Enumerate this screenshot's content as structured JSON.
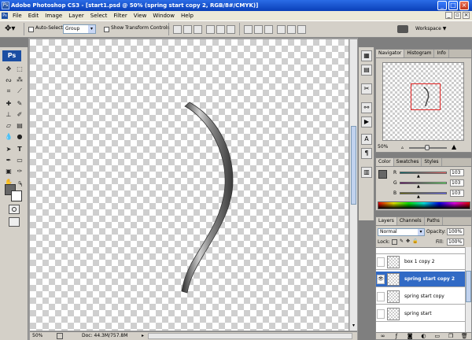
{
  "window": {
    "title": "Adobe Photoshop CS3 - [start1.psd @ 50% (spring start copy 2, RGB/8#/CMYK)]",
    "minimize": "_",
    "maximize": "□",
    "close": "×"
  },
  "app": {
    "logo": "Ps"
  },
  "menu": [
    "File",
    "Edit",
    "Image",
    "Layer",
    "Select",
    "Filter",
    "View",
    "Window",
    "Help"
  ],
  "doc_controls": {
    "minimize": "_",
    "restore": "▫",
    "close": "×"
  },
  "options": {
    "auto_select_label": "Auto-Select:",
    "auto_select_value": "Group",
    "show_transform_label": "Show Transform Controls",
    "workspace_label": "Workspace ▼"
  },
  "status": {
    "zoom": "50%",
    "doc": "Doc: 44.3M/757.8M"
  },
  "navigator": {
    "tabs": [
      "Navigator",
      "Histogram",
      "Info"
    ],
    "zoom": "50%"
  },
  "color": {
    "tabs": [
      "Color",
      "Swatches",
      "Styles"
    ],
    "channels": [
      {
        "label": "R",
        "value": "103"
      },
      {
        "label": "G",
        "value": "103"
      },
      {
        "label": "B",
        "value": "103"
      }
    ],
    "level": 0.4
  },
  "layers": {
    "tabs": [
      "Layers",
      "Channels",
      "Paths"
    ],
    "blend_mode": "Normal",
    "opacity_label": "Opacity:",
    "opacity": "100%",
    "lock_label": "Lock:",
    "fill_label": "Fill:",
    "fill": "100%",
    "items": [
      {
        "name": "box 1 copy 2",
        "visible": false,
        "selected": false
      },
      {
        "name": "spring start copy 2",
        "visible": true,
        "selected": true
      },
      {
        "name": "spring start copy",
        "visible": false,
        "selected": false
      },
      {
        "name": "spring start",
        "visible": false,
        "selected": false
      }
    ]
  },
  "colors": {
    "foreground": "#676767",
    "background": "#ffffff",
    "selection": "#316ac5",
    "navigator_box": "#e02020"
  }
}
